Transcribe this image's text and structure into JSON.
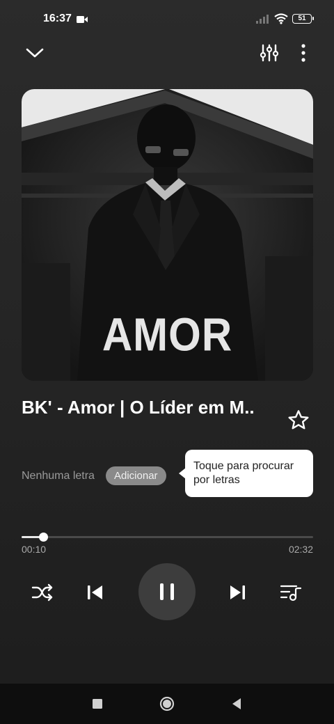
{
  "status_bar": {
    "time": "16:37",
    "battery": "51"
  },
  "header": {
    "collapse_icon": "chevron-down-icon",
    "equalizer_icon": "equalizer-icon",
    "more_icon": "more-vertical-icon"
  },
  "album": {
    "art_text": "AMOR"
  },
  "song": {
    "title": "BK' - Amor | O Líder em M..",
    "favorite_icon": "star-outline-icon"
  },
  "lyrics": {
    "status": "Nenhuma letra",
    "add_label": "Adicionar",
    "tooltip": "Toque para procurar por letras"
  },
  "progress": {
    "current": "00:10",
    "total": "02:32",
    "fraction": 0.075
  },
  "controls": {
    "shuffle_icon": "shuffle-icon",
    "previous_icon": "skip-previous-icon",
    "play_pause_icon": "pause-icon",
    "next_icon": "skip-next-icon",
    "queue_icon": "queue-music-icon"
  },
  "nav": {
    "recents_icon": "square-icon",
    "home_icon": "circle-icon",
    "back_icon": "triangle-back-icon"
  },
  "colors": {
    "background": "#262626",
    "accent": "#ffffff",
    "muted_text": "#9a9a9a",
    "add_button": "#8a8a8a"
  }
}
